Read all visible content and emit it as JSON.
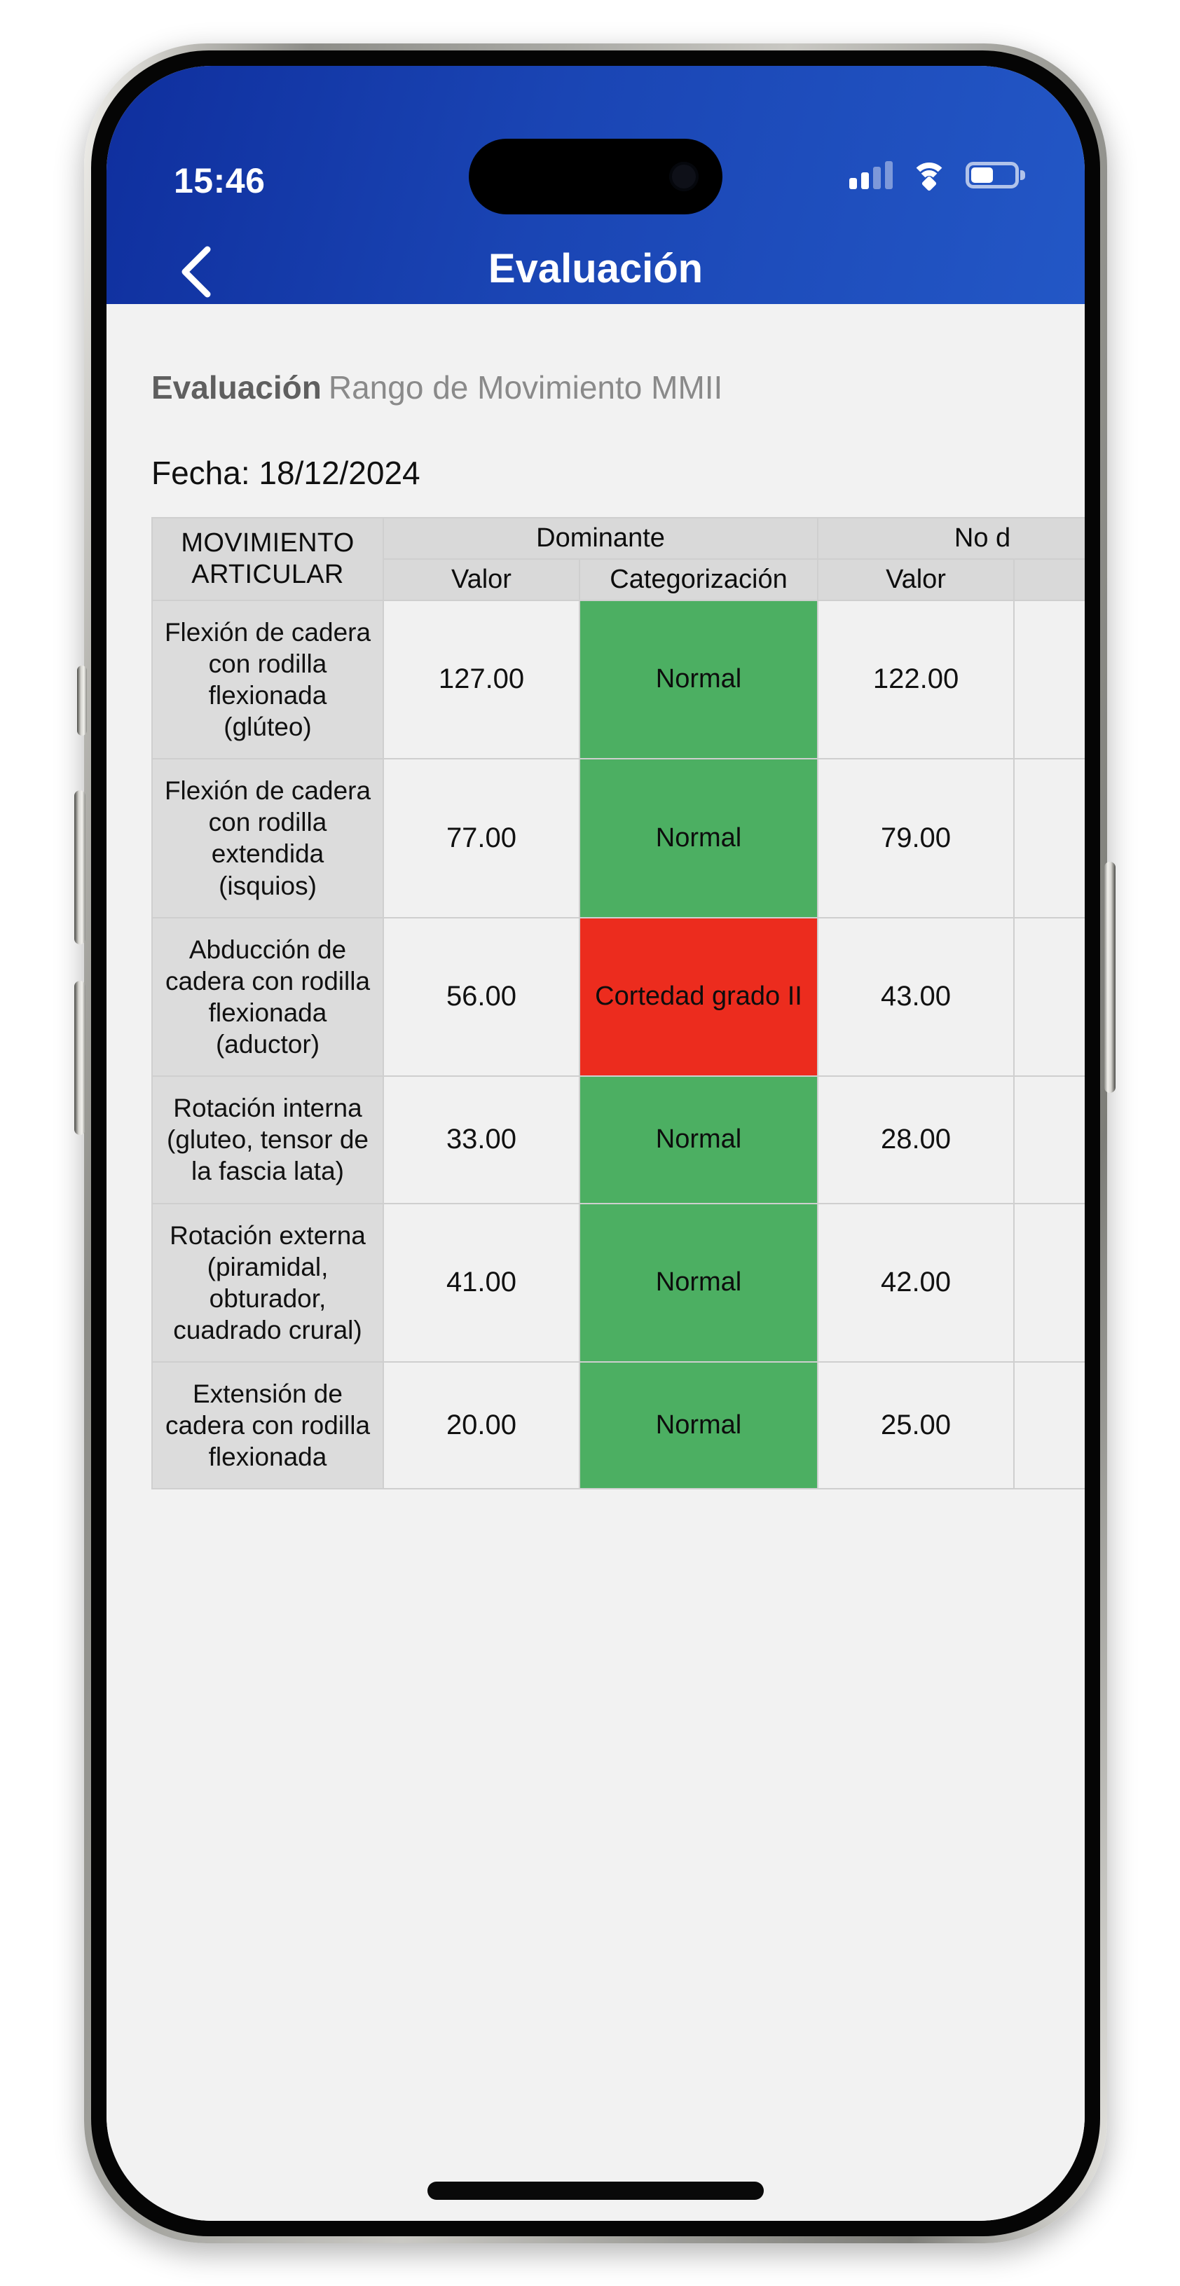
{
  "status_bar": {
    "time": "15:46",
    "icons": {
      "cellular": "cellular-signal-icon",
      "wifi": "wifi-icon",
      "battery": "battery-icon"
    }
  },
  "navbar": {
    "back_icon": "chevron-left-icon",
    "title": "Evaluación"
  },
  "content": {
    "heading_bold": "Evaluación",
    "heading_light": "Rango de Movimiento MMII",
    "fecha_label": "Fecha: 18/12/2024"
  },
  "table": {
    "header": {
      "movimiento": "MOVIMIENTO ARTICULAR",
      "group_dominante": "Dominante",
      "group_no_dominante": "No d",
      "dominante_valor": "Valor",
      "dominante_categorizacion": "Categorización",
      "no_dominante_valor": "Valor",
      "no_dominante_categorizacion": ""
    },
    "colors": {
      "normal": "#4caf62",
      "alert": "#ec2c1e",
      "header_bg": "#d9d9d9",
      "label_bg": "#dcdcdc",
      "value_bg": "#f1f1f1"
    },
    "rows": [
      {
        "movimiento": "Flexión de cadera con rodilla flexionada (glúteo)",
        "dom_valor": "127.00",
        "dom_cat": "Normal",
        "dom_cat_state": "normal",
        "nodom_valor": "122.00",
        "nodom_cat": ""
      },
      {
        "movimiento": "Flexión de cadera con rodilla extendida (isquios)",
        "dom_valor": "77.00",
        "dom_cat": "Normal",
        "dom_cat_state": "normal",
        "nodom_valor": "79.00",
        "nodom_cat": ""
      },
      {
        "movimiento": "Abducción de cadera con rodilla flexionada (aductor)",
        "dom_valor": "56.00",
        "dom_cat": "Cortedad grado II",
        "dom_cat_state": "alert",
        "nodom_valor": "43.00",
        "nodom_cat": ""
      },
      {
        "movimiento": "Rotación interna (gluteo, tensor de la fascia lata)",
        "dom_valor": "33.00",
        "dom_cat": "Normal",
        "dom_cat_state": "normal",
        "nodom_valor": "28.00",
        "nodom_cat": ""
      },
      {
        "movimiento": "Rotación externa (piramidal, obturador, cuadrado crural)",
        "dom_valor": "41.00",
        "dom_cat": "Normal",
        "dom_cat_state": "normal",
        "nodom_valor": "42.00",
        "nodom_cat": ""
      },
      {
        "movimiento": "Extensión de cadera con rodilla flexionada",
        "dom_valor": "20.00",
        "dom_cat": "Normal",
        "dom_cat_state": "normal",
        "nodom_valor": "25.00",
        "nodom_cat": ""
      }
    ]
  }
}
